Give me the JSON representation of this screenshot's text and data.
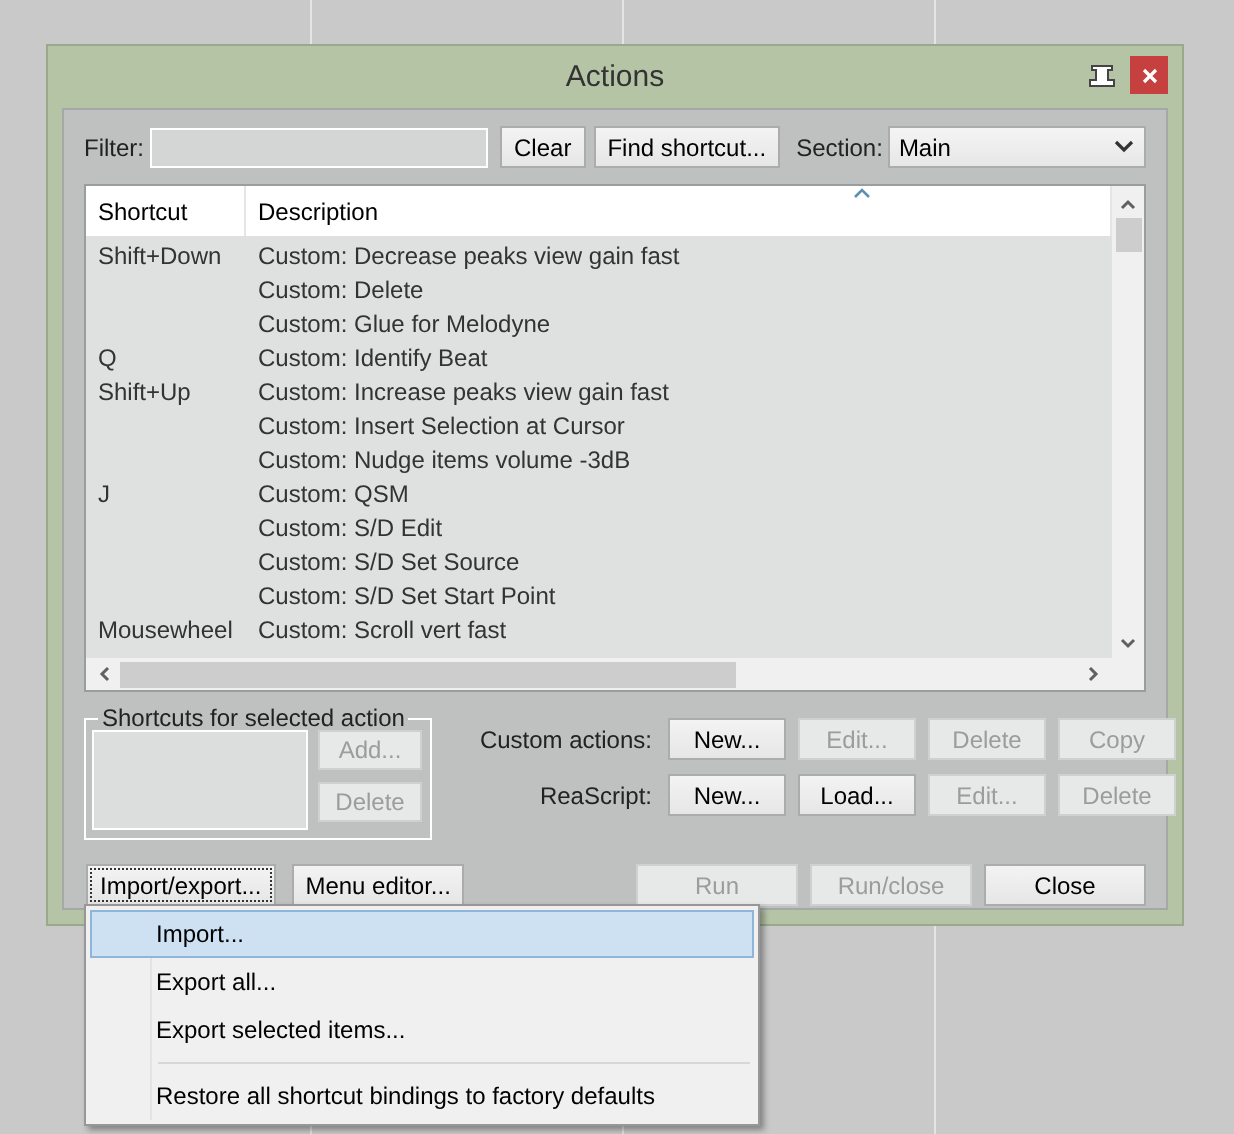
{
  "window": {
    "title": "Actions"
  },
  "filter": {
    "label": "Filter:"
  },
  "filter_buttons": [
    {
      "label": "Clear",
      "disabled": false
    },
    {
      "label": "Find shortcut...",
      "disabled": false
    }
  ],
  "section": {
    "label": "Section:",
    "value": "Main"
  },
  "table": {
    "columns": [
      "Shortcut",
      "Description"
    ],
    "rows": [
      {
        "shortcut": "Shift+Down",
        "description": "Custom: Decrease peaks view gain fast"
      },
      {
        "description": "Custom: Delete"
      },
      {
        "description": "Custom: Glue for Melodyne"
      },
      {
        "shortcut": "Q",
        "description": "Custom: Identify Beat"
      },
      {
        "shortcut": "Shift+Up",
        "description": "Custom: Increase peaks view gain fast"
      },
      {
        "description": "Custom: Insert Selection at Cursor"
      },
      {
        "description": "Custom: Nudge items volume -3dB"
      },
      {
        "shortcut": "J",
        "description": "Custom: QSM"
      },
      {
        "description": "Custom: S/D Edit"
      },
      {
        "description": "Custom: S/D Set Source"
      },
      {
        "description": "Custom: S/D Set Start Point"
      },
      {
        "shortcut": "Mousewheel",
        "description": "Custom: Scroll vert fast"
      }
    ]
  },
  "shortcuts_group": {
    "title": "Shortcuts for selected action",
    "buttons": [
      {
        "label": "Add...",
        "disabled": true
      },
      {
        "label": "Delete",
        "disabled": true
      }
    ]
  },
  "custom_actions": {
    "label": "Custom actions:",
    "buttons": [
      {
        "label": "New...",
        "disabled": false
      },
      {
        "label": "Edit...",
        "disabled": true
      },
      {
        "label": "Delete",
        "disabled": true
      },
      {
        "label": "Copy",
        "disabled": true
      }
    ]
  },
  "reascript": {
    "label": "ReaScript:",
    "buttons": [
      {
        "label": "New...",
        "disabled": false
      },
      {
        "label": "Load...",
        "disabled": false
      },
      {
        "label": "Edit...",
        "disabled": true
      },
      {
        "label": "Delete",
        "disabled": true
      }
    ]
  },
  "bottom_left_buttons": [
    {
      "label": "Import/export...",
      "focused": true
    },
    {
      "label": "Menu editor...",
      "focused": false
    }
  ],
  "bottom_right_buttons": [
    {
      "label": "Run",
      "disabled": true
    },
    {
      "label": "Run/close",
      "disabled": true
    },
    {
      "label": "Close",
      "disabled": false
    }
  ],
  "menu": {
    "items": [
      {
        "kind": "item",
        "label": "Import...",
        "selected": true
      },
      {
        "kind": "item",
        "label": "Export all...",
        "selected": false
      },
      {
        "kind": "item",
        "label": "Export selected items...",
        "selected": false
      },
      {
        "kind": "separator"
      },
      {
        "kind": "item",
        "label": "Restore all shortcut bindings to factory defaults",
        "selected": false
      }
    ]
  }
}
